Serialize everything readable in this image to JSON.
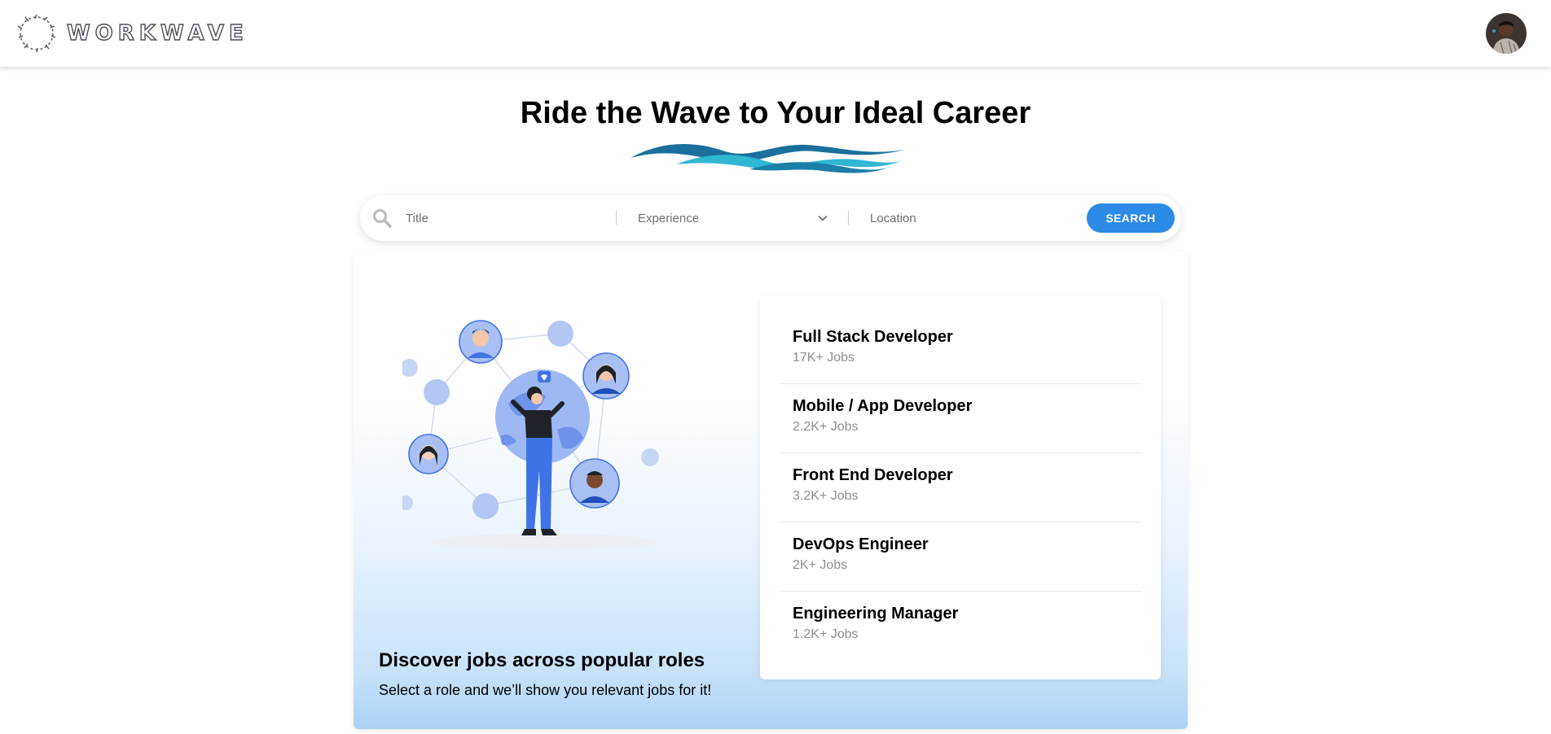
{
  "brand": {
    "name": "WORKWAVE"
  },
  "hero": {
    "title": "Ride the Wave to Your Ideal Career"
  },
  "search": {
    "title_placeholder": "Title",
    "experience_placeholder": "Experience",
    "location_placeholder": "Location",
    "button_label": "SEARCH"
  },
  "discover": {
    "title": "Discover jobs across popular roles",
    "subtitle": "Select a role and we’ll show you relevant jobs for it!"
  },
  "roles": [
    {
      "name": "Full Stack Developer",
      "count": "17K+ Jobs"
    },
    {
      "name": "Mobile / App Developer",
      "count": "2.2K+ Jobs"
    },
    {
      "name": "Front End Developer",
      "count": "3.2K+ Jobs"
    },
    {
      "name": "DevOps Engineer",
      "count": "2K+ Jobs"
    },
    {
      "name": "Engineering Manager",
      "count": "1.2K+ Jobs"
    }
  ],
  "colors": {
    "accent": "#2b8be6",
    "wave_dark": "#1b6f9c",
    "wave_light": "#2fb7d4"
  }
}
